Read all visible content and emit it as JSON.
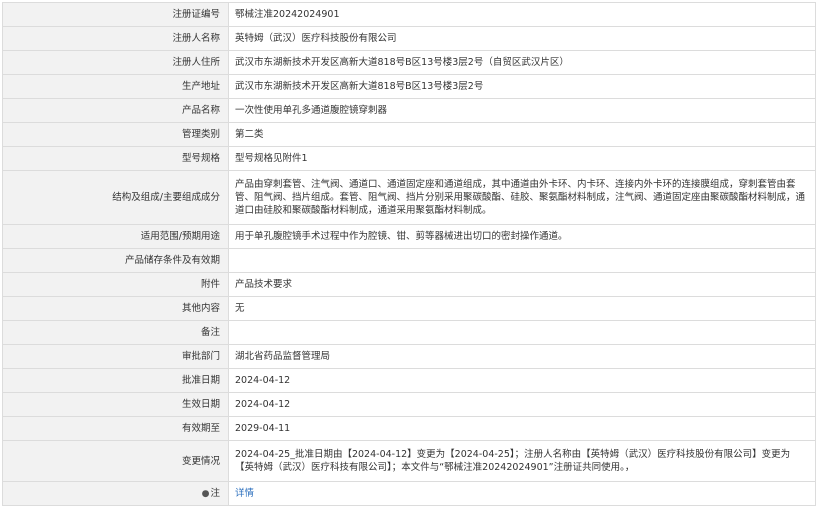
{
  "rows": [
    {
      "label": "注册证编号",
      "value": "鄂械注准20242024901"
    },
    {
      "label": "注册人名称",
      "value": "英特姆（武汉）医疗科技股份有限公司"
    },
    {
      "label": "注册人住所",
      "value": "武汉市东湖新技术开发区高新大道818号B区13号楼3层2号（自贸区武汉片区）"
    },
    {
      "label": "生产地址",
      "value": "武汉市东湖新技术开发区高新大道818号B区13号楼3层2号"
    },
    {
      "label": "产品名称",
      "value": "一次性使用单孔多通道腹腔镜穿刺器"
    },
    {
      "label": "管理类别",
      "value": "第二类"
    },
    {
      "label": "型号规格",
      "value": "型号规格见附件1"
    },
    {
      "label": "结构及组成/主要组成成分",
      "value": "产品由穿刺套管、注气阀、通道口、通道固定座和通道组成，其中通道由外卡环、内卡环、连接内外卡环的连接膜组成，穿刺套管由套管、阻气阀、挡片组成。套管、阻气阀、挡片分别采用聚碳酸酯、硅胶、聚氨酯材料制成，注气阀、通道固定座由聚碳酸酯材料制成，通道口由硅胶和聚碳酸酯材料制成，通道采用聚氨酯材料制成。"
    },
    {
      "label": "适用范围/预期用途",
      "value": "用于单孔腹腔镜手术过程中作为腔镜、钳、剪等器械进出切口的密封操作通道。"
    },
    {
      "label": "产品储存条件及有效期",
      "value": ""
    },
    {
      "label": "附件",
      "value": "产品技术要求"
    },
    {
      "label": "其他内容",
      "value": "无"
    },
    {
      "label": "备注",
      "value": ""
    },
    {
      "label": "审批部门",
      "value": "湖北省药品监督管理局"
    },
    {
      "label": "批准日期",
      "value": "2024-04-12"
    },
    {
      "label": "生效日期",
      "value": "2024-04-12"
    },
    {
      "label": "有效期至",
      "value": "2029-04-11"
    },
    {
      "label": "变更情况",
      "value": "2024-04-25_批准日期由【2024-04-12】变更为【2024-04-25】；注册人名称由【英特姆（武汉）医疗科技股份有限公司】变更为【英特姆（武汉）医疗科技有限公司】；本文件与“鄂械注准20242024901”注册证共同使用。，"
    }
  ],
  "note_row": {
    "label": "注",
    "pin_icon": "pin-icon",
    "link": "详情"
  }
}
